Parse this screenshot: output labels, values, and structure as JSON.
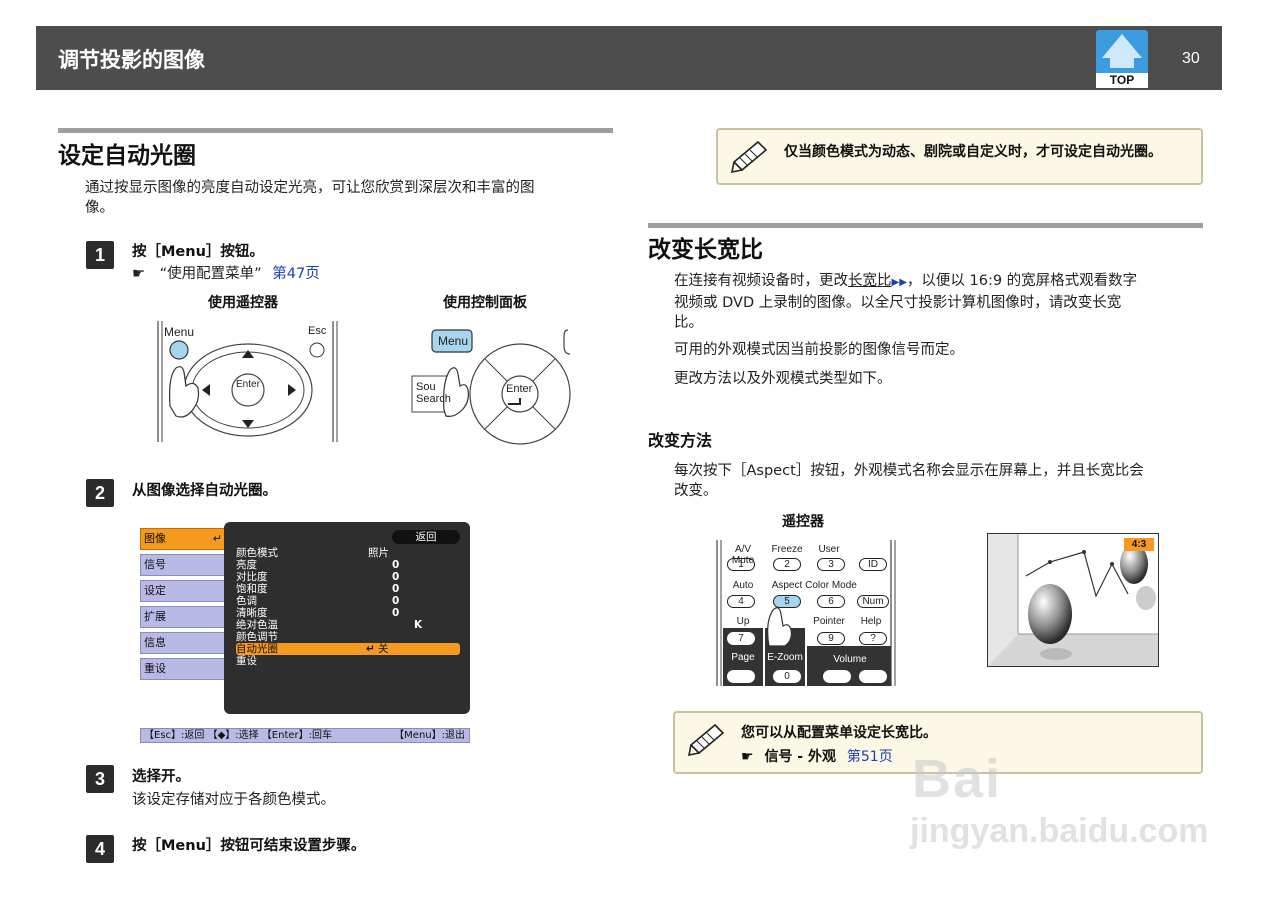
{
  "header": {
    "title": "调节投影的图像",
    "top_label": "TOP",
    "page_number": "30"
  },
  "left": {
    "section_title": "设定自动光圈",
    "intro": [
      "通过按显示图像的亮度自动设定光亮，可让您欣赏到深层次和丰富的图",
      "像。"
    ],
    "steps": [
      {
        "num": "1",
        "text": "按［Menu］按钮。"
      },
      {
        "num": "2",
        "text": "从图像选择自动光圈。"
      },
      {
        "num": "3",
        "text": "选择开。"
      },
      {
        "num": "4",
        "text": "按［Menu］按钮可结束设置步骤。"
      }
    ],
    "ref": {
      "pointer": "☛",
      "text": "“使用配置菜单”",
      "page": "第47页"
    },
    "caption_remote": "使用遥控器",
    "caption_panel": "使用控制面板",
    "remote_labels": {
      "menu": "Menu",
      "esc": "Esc",
      "enter": "Enter"
    },
    "panel_labels": {
      "menu": "Menu",
      "source_search_1": "Sou",
      "source_search_2": "Search",
      "enter": "Enter"
    },
    "step3_desc": "该设定存储对应于各颜色模式。",
    "menu": {
      "tabs": [
        "图像",
        "信号",
        "设定",
        "扩展",
        "信息",
        "重设"
      ],
      "back": "返回",
      "rows": [
        {
          "label": "颜色模式",
          "value": "照片"
        },
        {
          "label": "亮度",
          "value": "0"
        },
        {
          "label": "对比度",
          "value": "0"
        },
        {
          "label": "饱和度",
          "value": "0"
        },
        {
          "label": "色调",
          "value": "0"
        },
        {
          "label": "清晰度",
          "value": "0"
        },
        {
          "label": "绝对色温",
          "value": "K"
        },
        {
          "label": "颜色调节",
          "value": ""
        },
        {
          "label": "自动光圈",
          "value": "关"
        },
        {
          "label": "重设",
          "value": ""
        }
      ],
      "enter_glyph": "↵",
      "footer_left": "【Esc】:返回 【◆】:选择 【Enter】:回车",
      "footer_right": "【Menu】:退出"
    }
  },
  "right": {
    "note1": "仅当颜色模式为动态、剧院或自定义时，才可设定自动光圈。",
    "section_title": "改变长宽比",
    "para1_a": "在连接有视频设备时，更改",
    "para1_link": "长宽比",
    "para1_b": "，以便以 16:9 的宽屏格式观看数字",
    "para1_line2": "视频或 DVD 上录制的图像。以全尺寸投影计算机图像时，请改变长宽",
    "para1_line3": "比。",
    "para2": "可用的外观模式因当前投影的图像信号而定。",
    "para3": "更改方法以及外观模式类型如下。",
    "subhead": "改变方法",
    "para4_line1": "每次按下［Aspect］按钮，外观模式名称会显示在屏幕上，并且长宽比会",
    "para4_line2": "改变。",
    "caption_remote": "遥控器",
    "remote_keys": [
      {
        "label": "A/V Mute",
        "key": "1"
      },
      {
        "label": "Freeze",
        "key": "2"
      },
      {
        "label": "User",
        "key": "3"
      },
      {
        "label": "",
        "key": "ID"
      },
      {
        "label": "Auto",
        "key": "4"
      },
      {
        "label": "Aspect",
        "key": "5"
      },
      {
        "label": "Color Mode",
        "key": "6"
      },
      {
        "label": "",
        "key": "Num"
      },
      {
        "label": "Up",
        "key": "7"
      },
      {
        "label": "",
        "key": "8"
      },
      {
        "label": "Pointer",
        "key": "9"
      },
      {
        "label": "Help",
        "key": "?"
      }
    ],
    "remote_bottom": {
      "page": "Page",
      "ezoom": "E-Zoom",
      "zero": "0",
      "volume": "Volume"
    },
    "aspect_badge": "4:3",
    "note2_line1": "您可以从配置菜单设定长宽比。",
    "note2_pointer": "☛",
    "note2_ref": "信号 - 外观",
    "note2_page": "第51页"
  },
  "watermark": {
    "line1": "Bai",
    "line2": "jingyan.baidu.com"
  }
}
